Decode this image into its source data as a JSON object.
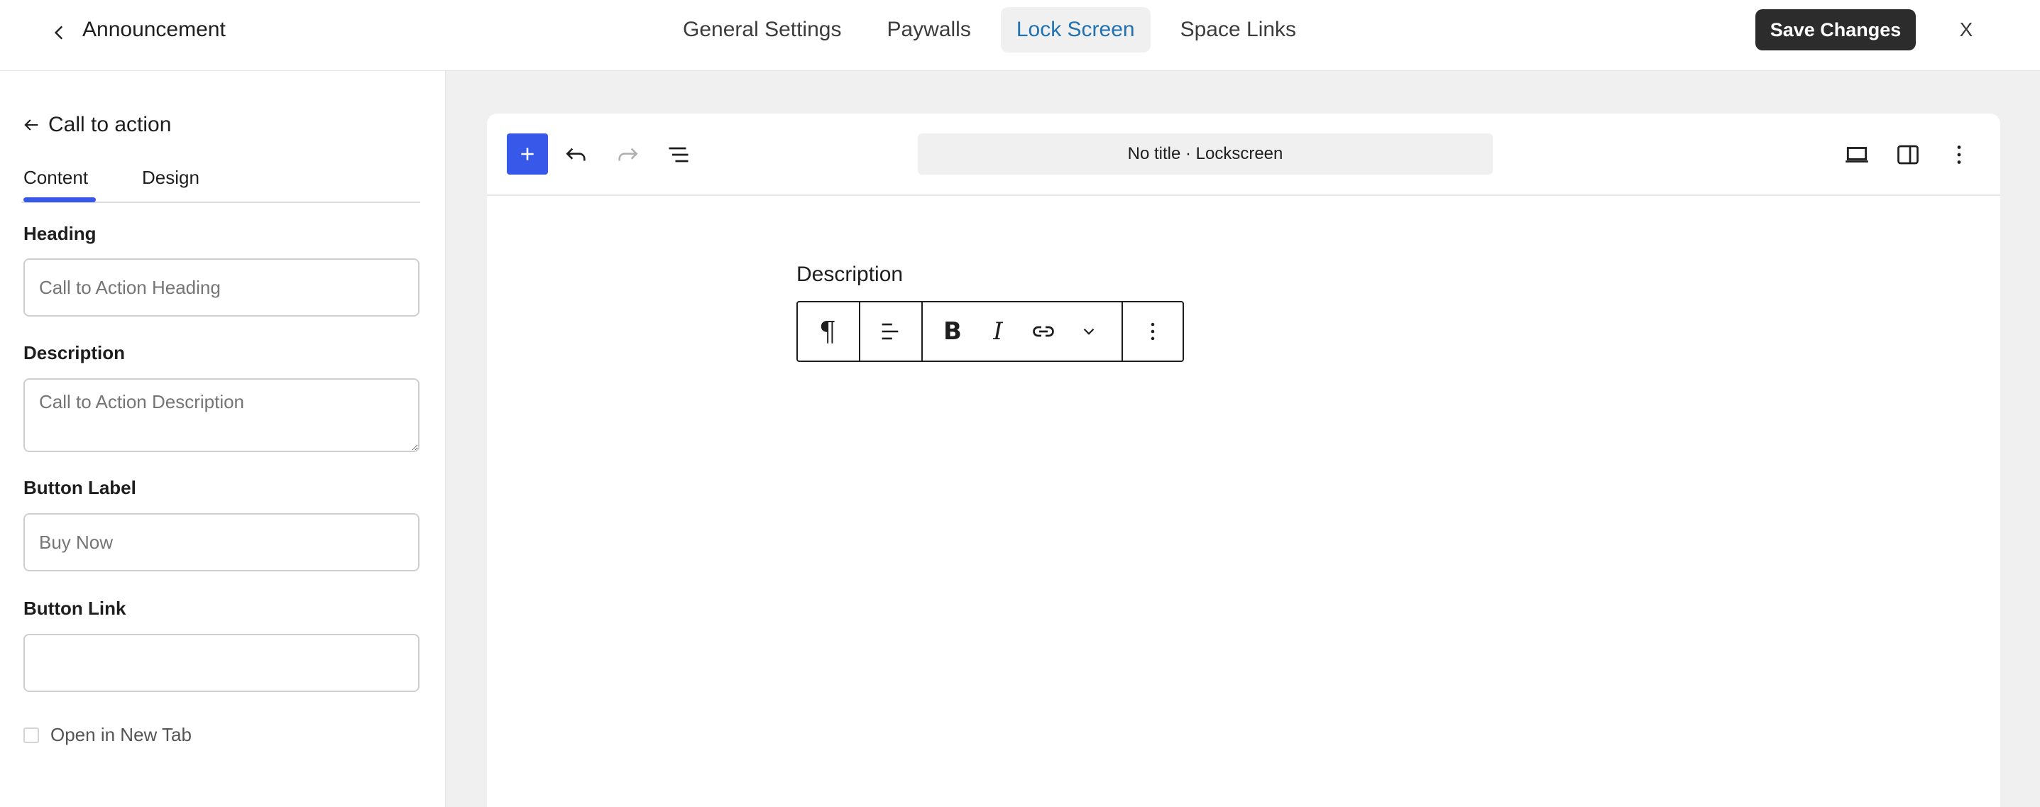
{
  "header": {
    "title": "Announcement",
    "tabs": [
      {
        "label": "General Settings"
      },
      {
        "label": "Paywalls"
      },
      {
        "label": "Lock Screen"
      },
      {
        "label": "Space Links"
      }
    ],
    "active_tab": "Lock Screen",
    "save_label": "Save Changes",
    "close_label": "X",
    "accent": "#2271b1"
  },
  "sidebar": {
    "back_label": "Call to action",
    "tabs": [
      {
        "label": "Content"
      },
      {
        "label": "Design"
      }
    ],
    "active_tab": "Content",
    "fields": {
      "heading": {
        "label": "Heading",
        "placeholder": "Call to Action Heading"
      },
      "description": {
        "label": "Description",
        "placeholder": "Call to Action Description"
      },
      "button_label": {
        "label": "Button Label",
        "placeholder": "Buy Now"
      },
      "button_link": {
        "label": "Button Link",
        "placeholder": ""
      }
    },
    "checkbox": {
      "label": "Open in New Tab",
      "checked": false
    }
  },
  "editor": {
    "document_title": "No title · Lockscreen",
    "block_label": "Description",
    "add_color": "#3858e9"
  },
  "icons": {
    "back": "chevron-left-icon",
    "sidebar_back": "arrow-left-icon",
    "add": "plus-icon",
    "undo": "undo-icon",
    "redo": "redo-icon",
    "outline": "list-view-icon",
    "view": "laptop-icon",
    "settings": "sidebar-panel-icon",
    "options": "more-vertical-icon",
    "paragraph": "pilcrow-icon",
    "align": "align-left-icon",
    "bold": "bold-icon",
    "italic": "italic-icon",
    "link": "link-icon",
    "more_format": "chevron-down-icon"
  }
}
